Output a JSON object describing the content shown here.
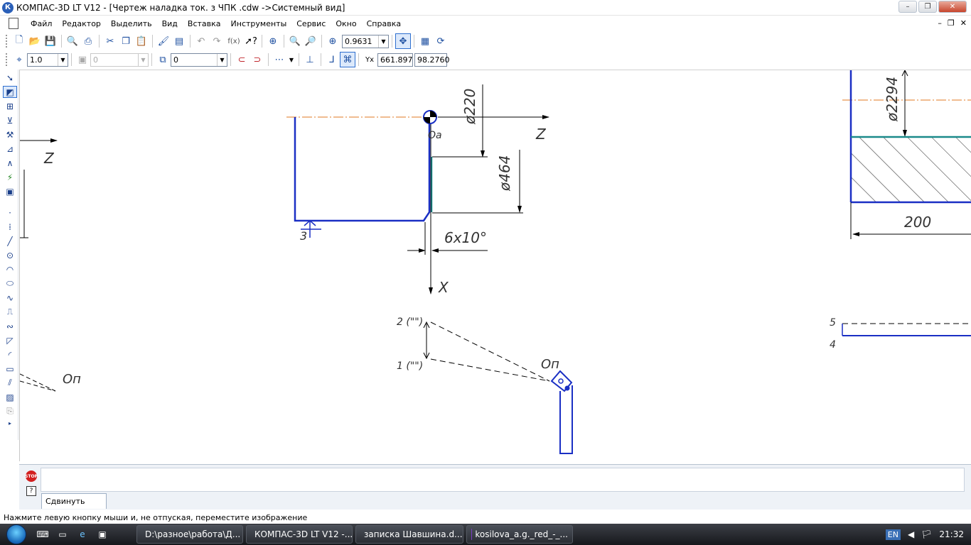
{
  "window": {
    "title": "КОМПАС-3D LT V12 - [Чертеж наладка ток. з ЧПК .cdw ->Системный вид]",
    "app_icon": "К",
    "controls": {
      "minimize": "–",
      "maximize": "❐",
      "close": "✕"
    }
  },
  "menu": {
    "items": [
      "Файл",
      "Редактор",
      "Выделить",
      "Вид",
      "Вставка",
      "Инструменты",
      "Сервис",
      "Окно",
      "Справка"
    ],
    "mdi_controls": {
      "minimize": "–",
      "restore": "❐",
      "close": "✕"
    }
  },
  "toolbar_standard": {
    "zoom_value": "0.9631",
    "icons": [
      "new-document-icon",
      "open-icon",
      "save-icon",
      "print-preview-icon",
      "print-icon",
      "cut-icon",
      "copy-icon",
      "paste-icon",
      "format-painter-icon",
      "properties-icon",
      "undo-icon",
      "redo-icon",
      "fx-icon",
      "help-pointer-icon",
      "zoom-window-icon",
      "zoom-in-icon",
      "zoom-out-icon",
      "zoom-scale-icon",
      "pan-icon",
      "refresh-icon",
      "manager-icon"
    ],
    "fx_label": "f(x)"
  },
  "toolbar_current_state": {
    "step": "1.0",
    "style_value": "0",
    "layer_value": "0",
    "coord_x": "661.897",
    "coord_y": "98.2760"
  },
  "drawing": {
    "labels": {
      "z_left": "Z",
      "z_top": "Z",
      "x_axis": "X",
      "o_zero": "Оа",
      "o_tool_right": "Оп",
      "o_tool_left": "Оп",
      "d220": "ø220",
      "d464": "ø464",
      "d2294": "ø2294",
      "chamfer": "6x10°",
      "pt3": "3",
      "pt2": "2 (\"\")",
      "pt1": "1 (\"\")",
      "dim200": "200",
      "n5": "5",
      "n4": "4"
    }
  },
  "command_panel": {
    "tab_label": "Сдвинуть",
    "stop_label": "STOP",
    "help_label": "?"
  },
  "status": {
    "message": "Нажмите левую кнопку мыши и, не отпуская, переместите изображение"
  },
  "taskbar": {
    "tasks": [
      {
        "label": "D:\\разное\\работа\\Д...",
        "color": "#e8b84a"
      },
      {
        "label": "КОМПАС-3D LT V12 -...",
        "color": "#2a5fb8"
      },
      {
        "label": "записка Шавшина.d...",
        "color": "#2b5797"
      },
      {
        "label": "kosilova_a.g._red_-_...",
        "color": "#7a3cc4"
      }
    ],
    "tray": {
      "lang": "EN",
      "time": "21:32"
    }
  }
}
